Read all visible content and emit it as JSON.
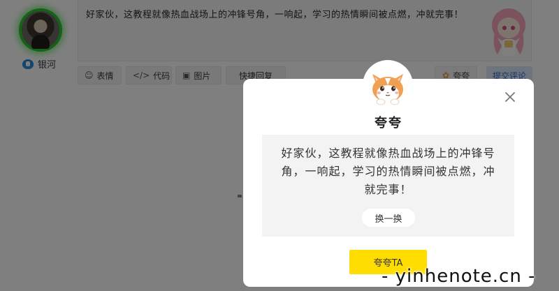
{
  "user": {
    "name": "银河",
    "avatar_icon": "user-avatar",
    "badge_icon": "heart-badge-icon"
  },
  "comment": {
    "text": "好家伙，这教程就像热血战场上的冲锋号角，一响起，学习的热情瞬间被点燃，冲就完事！"
  },
  "toolbar": {
    "emoji": {
      "icon": "☺",
      "label": "表情"
    },
    "code": {
      "icon": "</>",
      "label": "代码"
    },
    "image": {
      "icon": "▣",
      "label": "图片"
    },
    "quick_reply": {
      "label": "快捷回复"
    },
    "like": {
      "icon": "✿",
      "label": "夸夸"
    },
    "submit": {
      "label": "提交评论"
    }
  },
  "modal": {
    "title": "夸夸",
    "quote": "好家伙，这教程就像热血战场上的冲锋号角，一响起，学习的热情瞬间被点燃，冲就完事！",
    "change_label": "换一换",
    "praise_label": "夸夸TA",
    "accent_color": "#ffdd00"
  },
  "watermark": {
    "text": "- yinhenote.cn -"
  }
}
